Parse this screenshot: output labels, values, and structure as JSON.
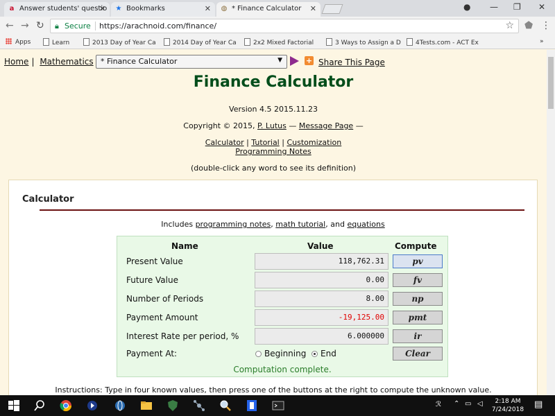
{
  "tabs": [
    {
      "label": "Answer students' questio",
      "icon": "answer-site-icon"
    },
    {
      "label": "Bookmarks",
      "icon": "star-icon"
    },
    {
      "label": "* Finance Calculator",
      "icon": "site-favicon"
    }
  ],
  "address": {
    "secure_label": "Secure",
    "url": "https://arachnoid.com/finance/"
  },
  "bookmarks": {
    "apps_label": "Apps",
    "items": [
      "Learn",
      "2013 Day of Year Ca",
      "2014 Day of Year Ca",
      "2x2 Mixed Factorial",
      "3 Ways to Assign a D",
      "4Tests.com - ACT Ex"
    ]
  },
  "nav": {
    "home": "Home",
    "math": "Mathematics",
    "page_select": "* Finance Calculator",
    "share": "Share This Page"
  },
  "header": {
    "title": "Finance Calculator",
    "version": "Version 4.5 2015.11.23",
    "copyright_prefix": "Copyright © 2015,",
    "author": "P. Lutus",
    "dash1": "—",
    "message_page": "Message Page",
    "dash2": "—",
    "link_calculator": "Calculator",
    "link_tutorial": "Tutorial",
    "link_customization": "Customization",
    "link_programming": "Programming Notes",
    "hint": "(double-click any word to see its definition)"
  },
  "calc": {
    "heading": "Calculator",
    "includes_prefix": "Includes",
    "link_prog_notes": "programming notes",
    "includes_mid": ", ",
    "link_math_tutorial": "math tutorial",
    "includes_and": ", and",
    "link_equations": "equations",
    "col_name": "Name",
    "col_value": "Value",
    "col_compute": "Compute",
    "rows": [
      {
        "label": "Present Value",
        "value": "118,762.31",
        "button": "pv"
      },
      {
        "label": "Future Value",
        "value": "0.00",
        "button": "fv"
      },
      {
        "label": "Number of Periods",
        "value": "8.00",
        "button": "np"
      },
      {
        "label": "Payment Amount",
        "value": "-19,125.00",
        "button": "pmt"
      },
      {
        "label": "Interest Rate per period, %",
        "value": "6.000000",
        "button": "ir"
      }
    ],
    "payment_at_label": "Payment At:",
    "opt_beginning": "Beginning",
    "opt_end": "End",
    "selected": "End",
    "clear_label": "Clear",
    "status": "Computation complete."
  },
  "instructions": "Instructions: Type in four known values, then press one of the buttons at the right to compute the unknown value.",
  "taskbar": {
    "time": "2:18 AM",
    "date": "7/24/2018"
  }
}
